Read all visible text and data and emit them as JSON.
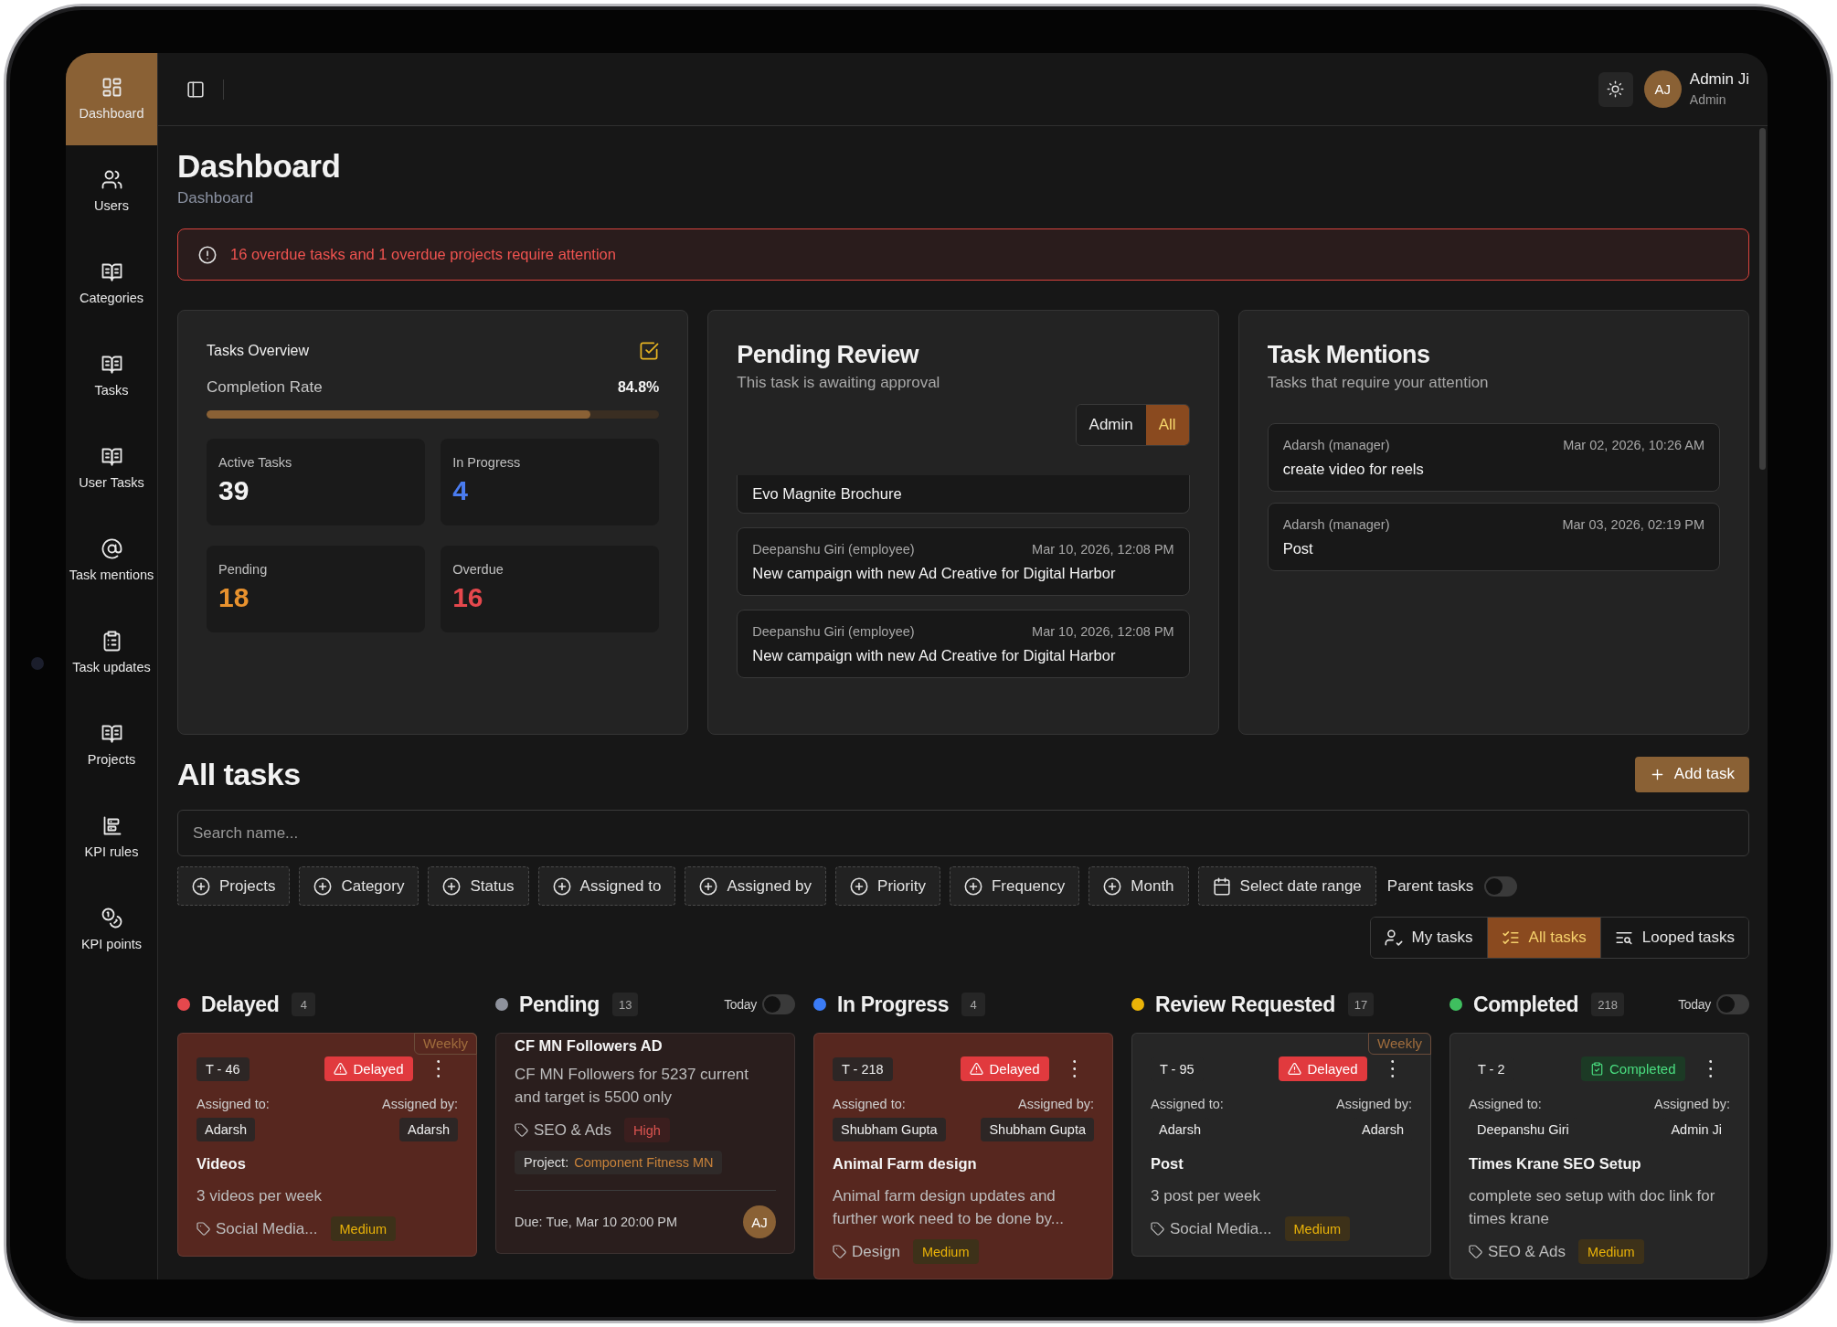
{
  "sidebar": {
    "items": [
      {
        "label": "Dashboard",
        "selected": true
      },
      {
        "label": "Users",
        "selected": false
      },
      {
        "label": "Categories",
        "selected": false
      },
      {
        "label": "Tasks",
        "selected": false
      },
      {
        "label": "User Tasks",
        "selected": false
      },
      {
        "label": "Task mentions",
        "selected": false
      },
      {
        "label": "Task updates",
        "selected": false
      },
      {
        "label": "Projects",
        "selected": false
      },
      {
        "label": "KPI rules",
        "selected": false
      },
      {
        "label": "KPI points",
        "selected": false
      }
    ]
  },
  "header": {
    "user": {
      "initials": "AJ",
      "name": "Admin Ji",
      "role": "Admin"
    }
  },
  "page": {
    "title": "Dashboard",
    "breadcrumb": "Dashboard"
  },
  "alert": {
    "text": "16 overdue tasks and 1 overdue projects require attention"
  },
  "overview": {
    "title": "Tasks Overview",
    "completion_label": "Completion Rate",
    "completion_value": "84.8%",
    "level": 0.848,
    "stats": [
      {
        "label": "Active Tasks",
        "value": "39",
        "color": "#f2f2f2"
      },
      {
        "label": "In Progress",
        "value": "4",
        "color": "#4a7cf0"
      },
      {
        "label": "Pending",
        "value": "18",
        "color": "#e8922e"
      },
      {
        "label": "Overdue",
        "value": "16",
        "color": "#e5484d"
      }
    ]
  },
  "pending_review": {
    "title": "Pending Review",
    "subtitle": "This task is awaiting approval",
    "filters": [
      {
        "label": "Admin",
        "selected": false
      },
      {
        "label": "All",
        "selected": true
      }
    ],
    "items": [
      {
        "title": "Evo Magnite Brochure"
      },
      {
        "author": "Deepanshu Giri (employee)",
        "date": "Mar 10, 2026, 12:08 PM",
        "title": "New campaign with new Ad Creative for Digital Harbor"
      },
      {
        "author": "Deepanshu Giri (employee)",
        "date": "Mar 10, 2026, 12:08 PM",
        "title": "New campaign with new Ad Creative for Digital Harbor"
      }
    ]
  },
  "task_mentions": {
    "title": "Task Mentions",
    "subtitle": "Tasks that require your attention",
    "items": [
      {
        "author": "Adarsh (manager)",
        "date": "Mar 02, 2026, 10:26 AM",
        "title": "create video for reels"
      },
      {
        "author": "Adarsh (manager)",
        "date": "Mar 03, 2026, 02:19 PM",
        "title": "Post"
      }
    ]
  },
  "all_tasks": {
    "title": "All tasks",
    "add_button": "Add task",
    "search": {
      "placeholder": "Search name..."
    },
    "filters": [
      {
        "label": "Projects",
        "kind": "add"
      },
      {
        "label": "Category",
        "kind": "add"
      },
      {
        "label": "Status",
        "kind": "add"
      },
      {
        "label": "Assigned to",
        "kind": "add"
      },
      {
        "label": "Assigned by",
        "kind": "add"
      },
      {
        "label": "Priority",
        "kind": "add"
      },
      {
        "label": "Frequency",
        "kind": "add"
      },
      {
        "label": "Month",
        "kind": "add"
      },
      {
        "label": "Select date range",
        "kind": "date"
      }
    ],
    "parent_tasks": {
      "label": "Parent tasks",
      "on": false
    },
    "views": [
      {
        "label": "My tasks",
        "selected": false
      },
      {
        "label": "All tasks",
        "selected": true
      },
      {
        "label": "Looped tasks",
        "selected": false
      }
    ]
  },
  "columns": [
    {
      "title": "Delayed",
      "color": "#e5484d",
      "count": "4",
      "cards": [
        {
          "color": "#57271f",
          "corner_tag": "Weekly",
          "id": "T - 46",
          "status": {
            "label": "Delayed",
            "kind": "delayed"
          },
          "assigned_to_label": "Assigned to:",
          "assigned_to": "Adarsh",
          "assigned_by_label": "Assigned by:",
          "assigned_by": "Adarsh",
          "title": "Videos",
          "description": "3 videos per week",
          "category": "Social Media...",
          "priority": {
            "label": "Medium",
            "kind": "medium"
          }
        }
      ]
    },
    {
      "title": "Pending",
      "color": "#8e929c",
      "count": "13",
      "today": {
        "label": "Today",
        "on": false
      },
      "cards": [
        {
          "color": "#2a1e1d",
          "title": "CF MN Followers AD",
          "description": "CF MN Followers for 5237 current and target is 5500 only",
          "category": "SEO & Ads",
          "priority": {
            "label": "High",
            "kind": "high"
          },
          "project_label": "Project:",
          "project": "Component Fitness MN",
          "due": "Due: Tue, Mar 10 20:00 PM",
          "avatar": "AJ"
        }
      ]
    },
    {
      "title": "In Progress",
      "color": "#3b7cf6",
      "count": "4",
      "cards": [
        {
          "color": "#57271f",
          "id": "T - 218",
          "status": {
            "label": "Delayed",
            "kind": "delayed"
          },
          "assigned_to_label": "Assigned to:",
          "assigned_to": "Shubham Gupta",
          "assigned_by_label": "Assigned by:",
          "assigned_by": "Shubham Gupta",
          "title": "Animal Farm design",
          "description": "Animal farm design updates and further work need to be done by...",
          "category": "Design",
          "priority": {
            "label": "Medium",
            "kind": "medium"
          }
        }
      ]
    },
    {
      "title": "Review Requested",
      "color": "#eab308",
      "count": "17",
      "cards": [
        {
          "color": "#262626",
          "corner_tag": "Weekly",
          "id": "T - 95",
          "status": {
            "label": "Delayed",
            "kind": "delayed"
          },
          "assigned_to_label": "Assigned to:",
          "assigned_to": "Adarsh",
          "assigned_by_label": "Assigned by:",
          "assigned_by": "Adarsh",
          "title": "Post",
          "description": "3 post per week",
          "category": "Social Media...",
          "priority": {
            "label": "Medium",
            "kind": "medium"
          }
        }
      ]
    },
    {
      "title": "Completed",
      "color": "#3fbf5f",
      "count": "218",
      "today": {
        "label": "Today",
        "on": false
      },
      "cards": [
        {
          "color": "#262626",
          "id": "T - 2",
          "status": {
            "label": "Completed",
            "kind": "completed"
          },
          "assigned_to_label": "Assigned to:",
          "assigned_to": "Deepanshu Giri",
          "assigned_by_label": "Assigned by:",
          "assigned_by": "Admin Ji",
          "title": "Times Krane SEO Setup",
          "description": "complete seo setup with doc link for times krane",
          "category": "SEO & Ads",
          "priority": {
            "label": "Medium",
            "kind": "medium"
          }
        }
      ]
    }
  ]
}
